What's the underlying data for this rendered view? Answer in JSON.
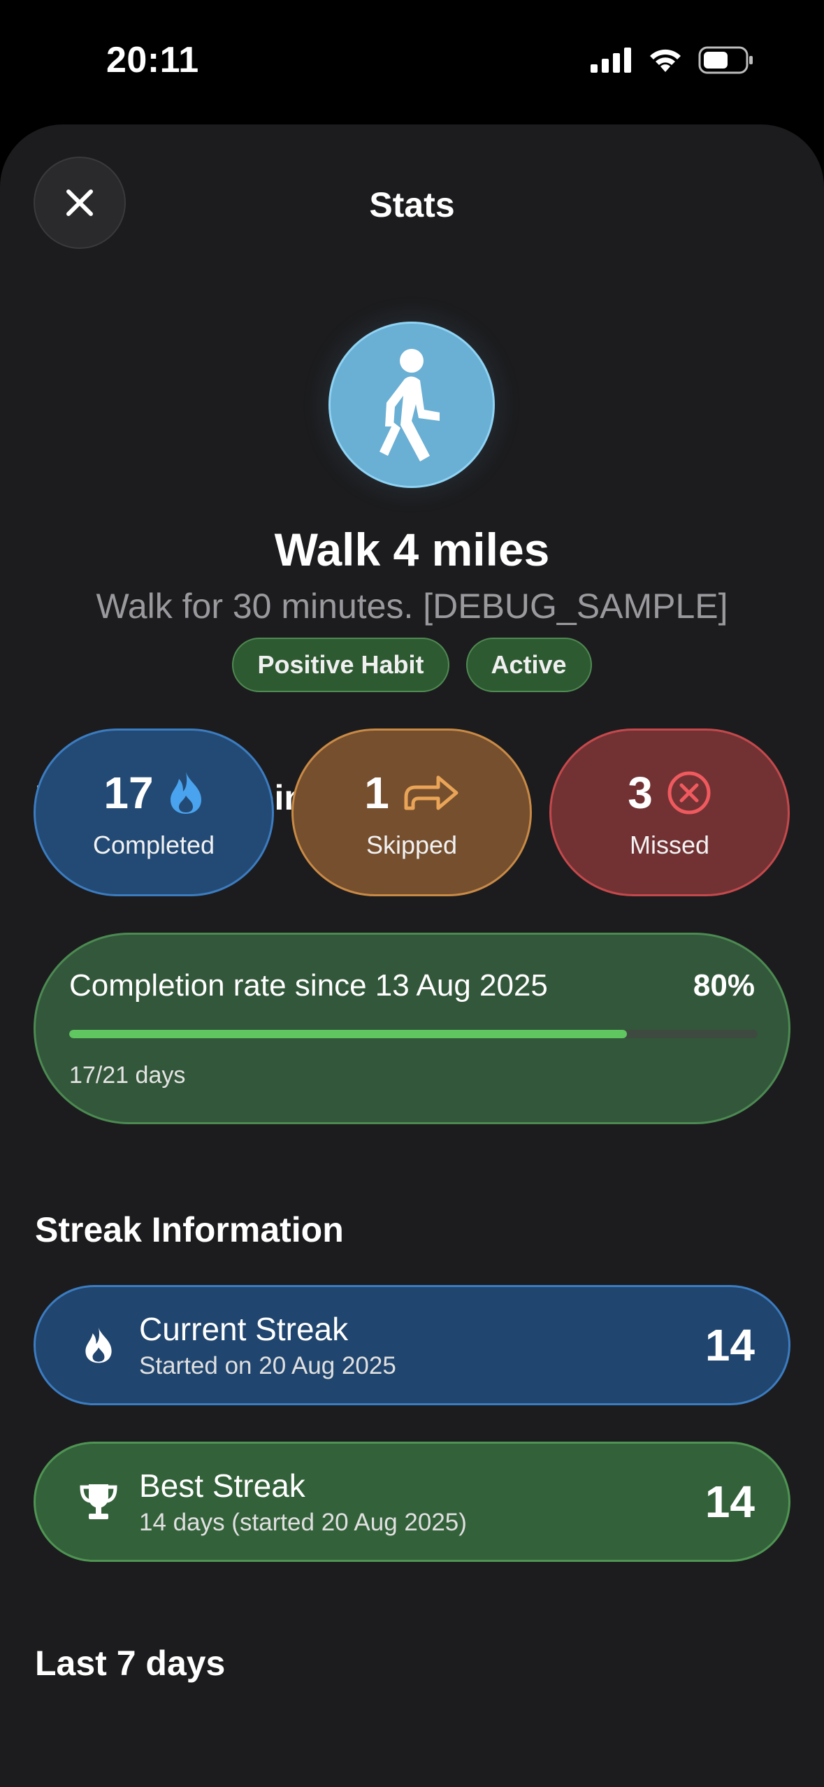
{
  "status": {
    "time": "20:11"
  },
  "header": {
    "title": "Stats"
  },
  "habit": {
    "title": "Walk 4 miles",
    "description": "Walk for 30 minutes. [DEBUG_SAMPLE]",
    "icon": "figure-walk-icon",
    "badges": [
      "Positive Habit",
      "Active"
    ]
  },
  "progress": {
    "section_title": "How you're doing",
    "completed": {
      "value": "17",
      "label": "Completed",
      "icon": "flame-icon"
    },
    "skipped": {
      "value": "1",
      "label": "Skipped",
      "icon": "arrow-turn-icon"
    },
    "missed": {
      "value": "3",
      "label": "Missed",
      "icon": "x-circle-icon"
    },
    "rate": {
      "label": "Completion rate since 13 Aug 2025",
      "percent_text": "80%",
      "fraction": 0.81,
      "days": "17/21 days"
    }
  },
  "streaks": {
    "section_title": "Streak Information",
    "current": {
      "name": "Current Streak",
      "sub": "Started on 20 Aug 2025",
      "value": "14",
      "icon": "flame-icon"
    },
    "best": {
      "name": "Best Streak",
      "sub": "14 days (started 20 Aug 2025)",
      "value": "14",
      "icon": "trophy-icon"
    }
  },
  "next_section": {
    "title": "Last 7 days"
  },
  "colors": {
    "completed": "#3c7cc0",
    "skipped": "#c98a46",
    "missed": "#c4494c",
    "positive": "#4f8a52",
    "progress_fill": "#5fc660"
  }
}
